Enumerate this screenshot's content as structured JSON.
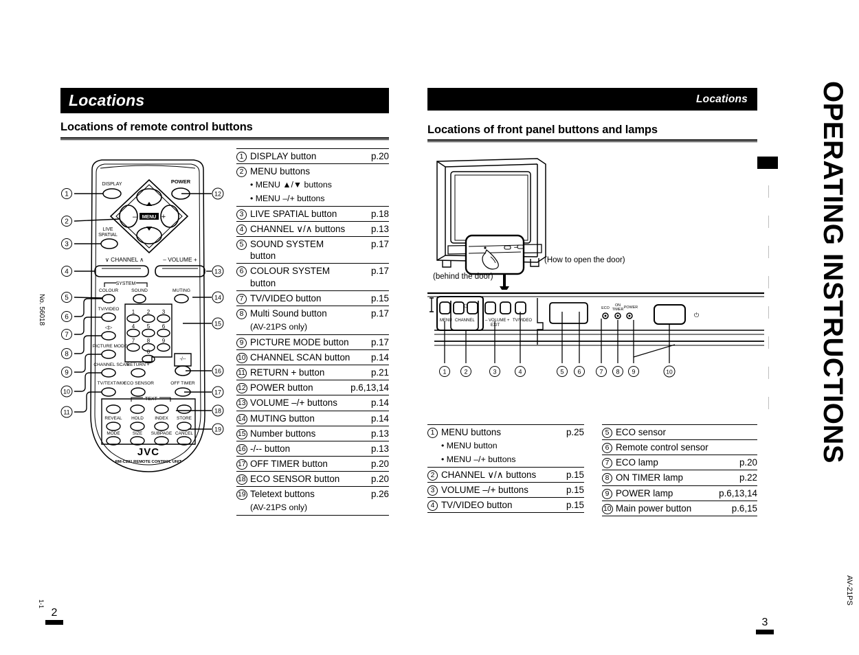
{
  "meta": {
    "doc_number": "No. 56018",
    "revision": "1-1",
    "model": "AV-21PS",
    "vertical_banner": "OPERATING INSTRUCTIONS",
    "left_page_number": "2",
    "right_page_number": "3"
  },
  "left_page": {
    "banner_title": "Locations",
    "section_heading": "Locations of remote control buttons",
    "items": [
      {
        "num": "1",
        "label": "DISPLAY button",
        "page": "p.20",
        "subs": [],
        "note": ""
      },
      {
        "num": "2",
        "label": "MENU buttons",
        "page": "",
        "subs": [
          "• MENU ▲/▼ buttons",
          "• MENU –/+ buttons"
        ],
        "note": ""
      },
      {
        "num": "3",
        "label": "LIVE SPATIAL button",
        "page": "p.18",
        "subs": [],
        "note": ""
      },
      {
        "num": "4",
        "label": "CHANNEL ∨/∧ buttons",
        "page": "p.13",
        "subs": [],
        "note": ""
      },
      {
        "num": "5",
        "label": "SOUND SYSTEM button",
        "page": "p.17",
        "subs": [],
        "note": ""
      },
      {
        "num": "6",
        "label": "COLOUR SYSTEM button",
        "page": "p.17",
        "subs": [],
        "note": ""
      },
      {
        "num": "7",
        "label": "TV/VIDEO button",
        "page": "p.15",
        "subs": [],
        "note": ""
      },
      {
        "num": "8",
        "label": "Multi Sound button",
        "page": "p.17",
        "subs": [],
        "note": "(AV-21PS only)"
      },
      {
        "num": "9",
        "label": "PICTURE MODE button",
        "page": "p.17",
        "subs": [],
        "note": ""
      },
      {
        "num": "10",
        "label": "CHANNEL SCAN button",
        "page": "p.14",
        "subs": [],
        "note": ""
      },
      {
        "num": "11",
        "label": "RETURN + button",
        "page": "p.21",
        "subs": [],
        "note": ""
      },
      {
        "num": "12",
        "label": "POWER button",
        "page": "p.6,13,14",
        "subs": [],
        "note": ""
      },
      {
        "num": "13",
        "label": "VOLUME –/+ buttons",
        "page": "p.14",
        "subs": [],
        "note": ""
      },
      {
        "num": "14",
        "label": "MUTING button",
        "page": "p.14",
        "subs": [],
        "note": ""
      },
      {
        "num": "15",
        "label": "Number buttons",
        "page": "p.13",
        "subs": [],
        "note": ""
      },
      {
        "num": "16",
        "label": "-/-- button",
        "page": "p.13",
        "subs": [],
        "note": ""
      },
      {
        "num": "17",
        "label": "OFF TIMER button",
        "page": "p.20",
        "subs": [],
        "note": ""
      },
      {
        "num": "18",
        "label": "ECO SENSOR button",
        "page": "p.20",
        "subs": [],
        "note": ""
      },
      {
        "num": "19",
        "label": "Teletext buttons",
        "page": "p.26",
        "subs": [],
        "note": "(AV-21PS only)"
      }
    ],
    "remote": {
      "brand": "JVC",
      "model_line": "RM-C231 REMOTE CONTROL UNIT",
      "labels": {
        "display": "DISPLAY",
        "power": "POWER",
        "menu": "MENU",
        "live_spatial_1": "LIVE",
        "live_spatial_2": "SPATIAL",
        "channel": "CHANNEL",
        "volume": "VOLUME",
        "system": "SYSTEM",
        "colour": "COLOUR",
        "sound": "SOUND",
        "muting": "MUTING",
        "tv_video": "TV/VIDEO",
        "picture_mode": "PICTURE MODE",
        "channel_scan": "CHANNEL SCAN",
        "return_plus": "RETURN +",
        "off_timer": "OFF TIMER",
        "minus_dashes": "-/--",
        "tv_text_mix": "TV/TEXT/MIX",
        "eco_sensor": "ECO SENSOR",
        "text": "TEXT",
        "reveal": "REVEAL",
        "hold": "HOLD",
        "index": "INDEX",
        "store": "STORE",
        "mode": "MODE",
        "size": "SIZE",
        "subpage": "SUBPAGE",
        "cancel": "CANCEL"
      },
      "numpad": [
        "1",
        "2",
        "3",
        "4",
        "5",
        "6",
        "7",
        "8",
        "9",
        "0"
      ],
      "callouts_left": [
        "1",
        "2",
        "3",
        "4",
        "5",
        "6",
        "7",
        "8",
        "9",
        "10",
        "11"
      ],
      "callouts_right": [
        "12",
        "13",
        "14",
        "15",
        "16",
        "17",
        "18",
        "19"
      ]
    }
  },
  "right_page": {
    "banner_title": "Locations",
    "section_heading": "Locations of front panel buttons and lamps",
    "tv_diagram": {
      "behind_door": "(behind the door)",
      "how_to_open": "(How to open the door)"
    },
    "panel_labels": {
      "menu": "MENU",
      "channel": "CHANNEL",
      "volume": "VOLUME",
      "exit": "EXIT",
      "tv_video": "TV/VIDEO",
      "minus": "–",
      "plus": "+",
      "eco": "ECO",
      "on_timer_1": "ON",
      "on_timer_2": "TIMER",
      "power": "POWER"
    },
    "panel_callouts": [
      "1",
      "2",
      "3",
      "4",
      "5",
      "6",
      "7",
      "8",
      "9",
      "10"
    ],
    "items_left": [
      {
        "num": "1",
        "label": "MENU buttons",
        "page": "p.25",
        "subs": [
          "• MENU button",
          "• MENU –/+ buttons"
        ]
      },
      {
        "num": "2",
        "label": "CHANNEL ∨/∧ buttons",
        "page": "p.15",
        "subs": []
      },
      {
        "num": "3",
        "label": "VOLUME –/+ buttons",
        "page": "p.15",
        "subs": []
      },
      {
        "num": "4",
        "label": "TV/VIDEO button",
        "page": "p.15",
        "subs": []
      }
    ],
    "items_right": [
      {
        "num": "5",
        "label": "ECO sensor",
        "page": ""
      },
      {
        "num": "6",
        "label": "Remote control sensor",
        "page": ""
      },
      {
        "num": "7",
        "label": "ECO lamp",
        "page": "p.20"
      },
      {
        "num": "8",
        "label": "ON TIMER lamp",
        "page": "p.22"
      },
      {
        "num": "9",
        "label": "POWER lamp",
        "page": "p.6,13,14"
      },
      {
        "num": "10",
        "label": "Main power button",
        "page": "p.6,15"
      }
    ]
  }
}
